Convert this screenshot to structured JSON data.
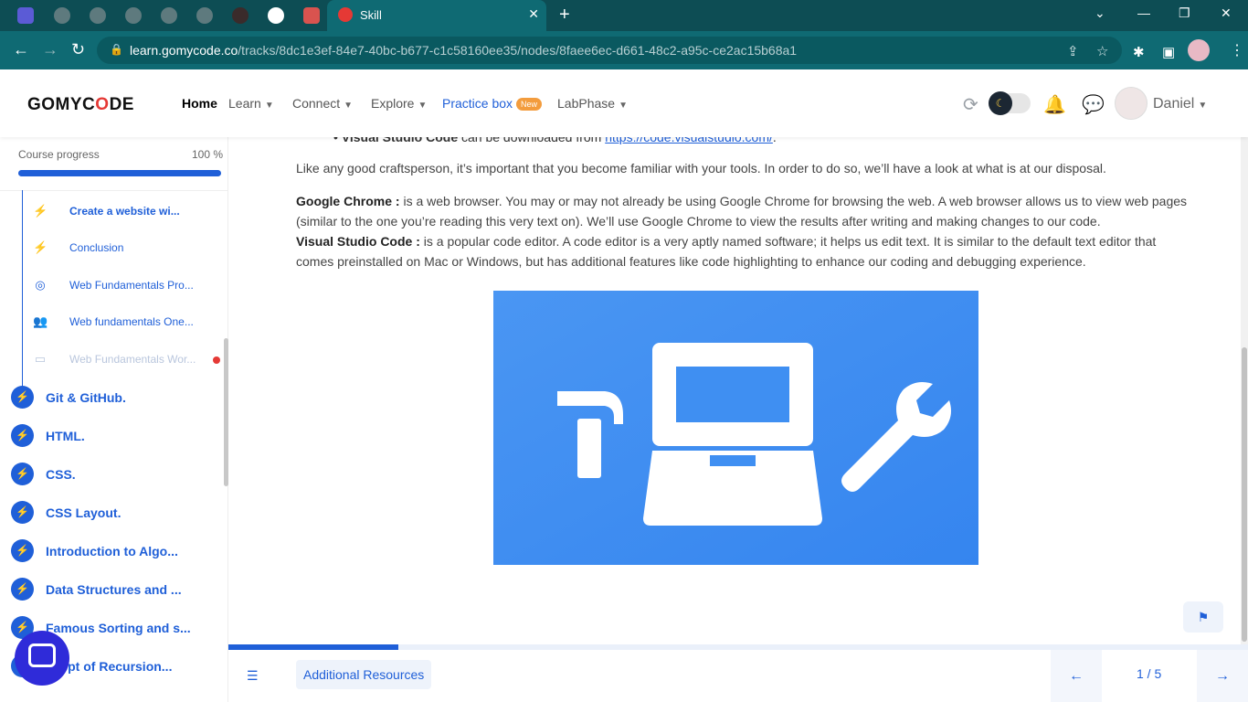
{
  "browser": {
    "tab_title": "Skill",
    "tab_close": "✕",
    "new_tab": "+",
    "url_host": "learn.gomycode.co",
    "url_path": "/tracks/8dc1e3ef-84e7-40bc-b677-c1c58160ee35/nodes/8faee6ec-d661-48c2-a95c-ce2ac15b68a1",
    "window_controls": [
      "⌄",
      "—",
      "❐",
      "✕"
    ]
  },
  "header": {
    "logo_prefix": "GOMYC",
    "logo_o": "O",
    "logo_suffix": "DE",
    "nav": [
      {
        "label": "Home"
      },
      {
        "label": "Learn"
      },
      {
        "label": "Connect"
      },
      {
        "label": "Explore"
      },
      {
        "label": "Practice box",
        "badge": "New"
      },
      {
        "label": "LabPhase"
      }
    ],
    "username": "Daniel"
  },
  "sidebar": {
    "progress_label": "Course progress",
    "progress_value": "100 %",
    "progress_fraction": 1.0,
    "lessons": [
      {
        "label": "Create a website wi...",
        "icon": "bolt-icon",
        "bold": true
      },
      {
        "label": "Conclusion",
        "icon": "bolt-icon"
      },
      {
        "label": "Web Fundamentals Pro...",
        "icon": "target-icon"
      },
      {
        "label": "Web fundamentals One...",
        "icon": "people-icon"
      },
      {
        "label": "Web Fundamentals Wor...",
        "icon": "workshop-icon",
        "dim": true,
        "dot": true
      }
    ],
    "chapters": [
      {
        "label": "Git & GitHub."
      },
      {
        "label": "HTML."
      },
      {
        "label": "CSS."
      },
      {
        "label": "CSS Layout."
      },
      {
        "label": "Introduction to Algo..."
      },
      {
        "label": "Data Structures and ..."
      },
      {
        "label": "Famous Sorting and s..."
      },
      {
        "label": "ncept of Recursion..."
      }
    ]
  },
  "content": {
    "bullet_label": "Visual Studio Code",
    "bullet_text": " can be downloaded from ",
    "bullet_link": "https://code.visualstudio.com/",
    "bullet_end": ".",
    "intro": "Like any good craftsperson, it’s important that you become familiar with your tools. In order to do so, we’ll have a look at what is at our disposal.",
    "chrome_label": "Google Chrome :",
    "chrome_text": " is a web browser. You may or may not already be using Google Chrome for browsing the web. A web browser allows us to view web pages (similar to the one you’re reading this very text on). We’ll use Google Chrome to view the results after writing and making changes to our code.",
    "vscode_label": "Visual Studio Code :",
    "vscode_text": " is a popular code editor. A code editor is a very aptly named software; it helps us edit text. It is similar to the default text editor that comes preinstalled on Mac or Windows, but has additional features like code highlighting to enhance our coding and debugging experience."
  },
  "footer": {
    "resources_label": "Additional Resources",
    "pager": "1 / 5",
    "progress_fraction": 0.167
  },
  "colors": {
    "accent": "#1f5fd8",
    "hero_bg": "#3f8ff2",
    "browser_teal": "#0f6a73"
  }
}
